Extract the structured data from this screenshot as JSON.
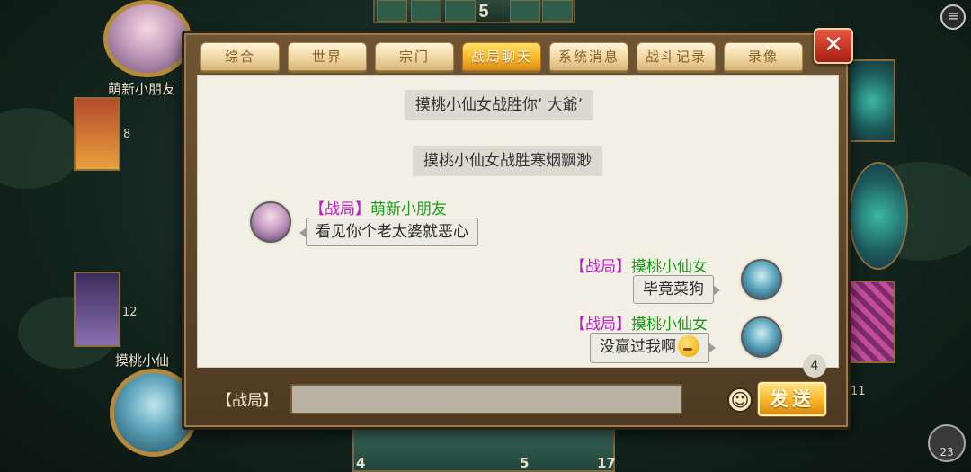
{
  "board": {
    "top_count": "5",
    "opponent_name": "萌新小朋友",
    "self_name": "摸桃小仙",
    "side_counts": {
      "card_a": "8",
      "card_b": "12",
      "right": "11"
    },
    "bottom_counts": [
      "4",
      "5",
      "17"
    ],
    "friends_count": "23",
    "partial_timer": "08"
  },
  "dialog": {
    "tabs": [
      {
        "label": "综合",
        "active": false
      },
      {
        "label": "世界",
        "active": false
      },
      {
        "label": "宗门",
        "active": false
      },
      {
        "label": "战局聊天",
        "active": true
      },
      {
        "label": "系统消息",
        "active": false
      },
      {
        "label": "战斗记录",
        "active": false
      },
      {
        "label": "录像",
        "active": false
      }
    ],
    "close_label": "✕",
    "system_messages": [
      "摸桃小仙女战胜你’ 大爺’",
      "摸桃小仙女战胜寒烟飘渺"
    ],
    "messages": [
      {
        "side": "left",
        "channel": "【战局】",
        "sender": "萌新小朋友",
        "text": "看见你个老太婆就恶心"
      },
      {
        "side": "right",
        "channel": "【战局】",
        "sender": "摸桃小仙女",
        "text": "毕竟菜狗"
      },
      {
        "side": "right",
        "channel": "【战局】",
        "sender": "摸桃小仙女",
        "text": "没赢过我啊",
        "emoji": "thinking-face-emoji"
      }
    ],
    "unread_count": "4",
    "input": {
      "channel_label": "【战局】",
      "value": "",
      "placeholder": ""
    },
    "emoji_button_icon": "smile-icon",
    "send_label": "发送"
  },
  "colors": {
    "channel_tag": "#c01ec8",
    "nickname": "#1a9a1a",
    "active_tab": "#f6b62a",
    "close_button": "#c7321f"
  }
}
